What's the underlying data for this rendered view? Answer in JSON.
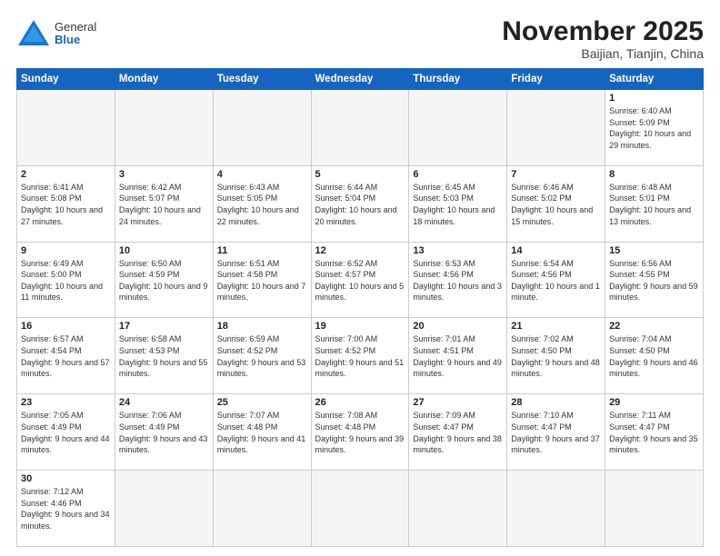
{
  "header": {
    "logo_general": "General",
    "logo_blue": "Blue",
    "month_title": "November 2025",
    "subtitle": "Baijian, Tianjin, China"
  },
  "weekdays": [
    "Sunday",
    "Monday",
    "Tuesday",
    "Wednesday",
    "Thursday",
    "Friday",
    "Saturday"
  ],
  "weeks": [
    [
      {
        "day": "",
        "info": ""
      },
      {
        "day": "",
        "info": ""
      },
      {
        "day": "",
        "info": ""
      },
      {
        "day": "",
        "info": ""
      },
      {
        "day": "",
        "info": ""
      },
      {
        "day": "",
        "info": ""
      },
      {
        "day": "1",
        "info": "Sunrise: 6:40 AM\nSunset: 5:09 PM\nDaylight: 10 hours and 29 minutes."
      }
    ],
    [
      {
        "day": "2",
        "info": "Sunrise: 6:41 AM\nSunset: 5:08 PM\nDaylight: 10 hours and 27 minutes."
      },
      {
        "day": "3",
        "info": "Sunrise: 6:42 AM\nSunset: 5:07 PM\nDaylight: 10 hours and 24 minutes."
      },
      {
        "day": "4",
        "info": "Sunrise: 6:43 AM\nSunset: 5:05 PM\nDaylight: 10 hours and 22 minutes."
      },
      {
        "day": "5",
        "info": "Sunrise: 6:44 AM\nSunset: 5:04 PM\nDaylight: 10 hours and 20 minutes."
      },
      {
        "day": "6",
        "info": "Sunrise: 6:45 AM\nSunset: 5:03 PM\nDaylight: 10 hours and 18 minutes."
      },
      {
        "day": "7",
        "info": "Sunrise: 6:46 AM\nSunset: 5:02 PM\nDaylight: 10 hours and 15 minutes."
      },
      {
        "day": "8",
        "info": "Sunrise: 6:48 AM\nSunset: 5:01 PM\nDaylight: 10 hours and 13 minutes."
      }
    ],
    [
      {
        "day": "9",
        "info": "Sunrise: 6:49 AM\nSunset: 5:00 PM\nDaylight: 10 hours and 11 minutes."
      },
      {
        "day": "10",
        "info": "Sunrise: 6:50 AM\nSunset: 4:59 PM\nDaylight: 10 hours and 9 minutes."
      },
      {
        "day": "11",
        "info": "Sunrise: 6:51 AM\nSunset: 4:58 PM\nDaylight: 10 hours and 7 minutes."
      },
      {
        "day": "12",
        "info": "Sunrise: 6:52 AM\nSunset: 4:57 PM\nDaylight: 10 hours and 5 minutes."
      },
      {
        "day": "13",
        "info": "Sunrise: 6:53 AM\nSunset: 4:56 PM\nDaylight: 10 hours and 3 minutes."
      },
      {
        "day": "14",
        "info": "Sunrise: 6:54 AM\nSunset: 4:56 PM\nDaylight: 10 hours and 1 minute."
      },
      {
        "day": "15",
        "info": "Sunrise: 6:56 AM\nSunset: 4:55 PM\nDaylight: 9 hours and 59 minutes."
      }
    ],
    [
      {
        "day": "16",
        "info": "Sunrise: 6:57 AM\nSunset: 4:54 PM\nDaylight: 9 hours and 57 minutes."
      },
      {
        "day": "17",
        "info": "Sunrise: 6:58 AM\nSunset: 4:53 PM\nDaylight: 9 hours and 55 minutes."
      },
      {
        "day": "18",
        "info": "Sunrise: 6:59 AM\nSunset: 4:52 PM\nDaylight: 9 hours and 53 minutes."
      },
      {
        "day": "19",
        "info": "Sunrise: 7:00 AM\nSunset: 4:52 PM\nDaylight: 9 hours and 51 minutes."
      },
      {
        "day": "20",
        "info": "Sunrise: 7:01 AM\nSunset: 4:51 PM\nDaylight: 9 hours and 49 minutes."
      },
      {
        "day": "21",
        "info": "Sunrise: 7:02 AM\nSunset: 4:50 PM\nDaylight: 9 hours and 48 minutes."
      },
      {
        "day": "22",
        "info": "Sunrise: 7:04 AM\nSunset: 4:50 PM\nDaylight: 9 hours and 46 minutes."
      }
    ],
    [
      {
        "day": "23",
        "info": "Sunrise: 7:05 AM\nSunset: 4:49 PM\nDaylight: 9 hours and 44 minutes."
      },
      {
        "day": "24",
        "info": "Sunrise: 7:06 AM\nSunset: 4:49 PM\nDaylight: 9 hours and 43 minutes."
      },
      {
        "day": "25",
        "info": "Sunrise: 7:07 AM\nSunset: 4:48 PM\nDaylight: 9 hours and 41 minutes."
      },
      {
        "day": "26",
        "info": "Sunrise: 7:08 AM\nSunset: 4:48 PM\nDaylight: 9 hours and 39 minutes."
      },
      {
        "day": "27",
        "info": "Sunrise: 7:09 AM\nSunset: 4:47 PM\nDaylight: 9 hours and 38 minutes."
      },
      {
        "day": "28",
        "info": "Sunrise: 7:10 AM\nSunset: 4:47 PM\nDaylight: 9 hours and 37 minutes."
      },
      {
        "day": "29",
        "info": "Sunrise: 7:11 AM\nSunset: 4:47 PM\nDaylight: 9 hours and 35 minutes."
      }
    ],
    [
      {
        "day": "30",
        "info": "Sunrise: 7:12 AM\nSunset: 4:46 PM\nDaylight: 9 hours and 34 minutes."
      },
      {
        "day": "",
        "info": ""
      },
      {
        "day": "",
        "info": ""
      },
      {
        "day": "",
        "info": ""
      },
      {
        "day": "",
        "info": ""
      },
      {
        "day": "",
        "info": ""
      },
      {
        "day": "",
        "info": ""
      }
    ]
  ]
}
